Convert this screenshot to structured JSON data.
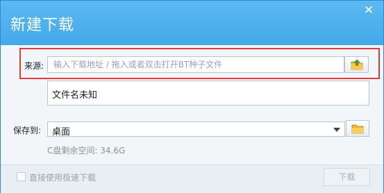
{
  "dialog": {
    "title": "新建下载",
    "close_glyph": "✕"
  },
  "source": {
    "label": "来源:",
    "placeholder": "输入下载地址 / 拖入或者双击打开BT种子文件",
    "browse_icon": "upload-folder-icon"
  },
  "file": {
    "name": "文件名未知"
  },
  "save": {
    "label": "保存到:",
    "location": "桌面",
    "folder_icon": "folder-icon"
  },
  "disk": {
    "free_space": "C盘剩余空间: 34.6G"
  },
  "footer": {
    "checkbox_label": "直接使用极速下载",
    "checkbox_checked": false,
    "download_label": "下载"
  },
  "colors": {
    "title_bar": "#44a9ea",
    "highlight_border": "#e53838"
  }
}
